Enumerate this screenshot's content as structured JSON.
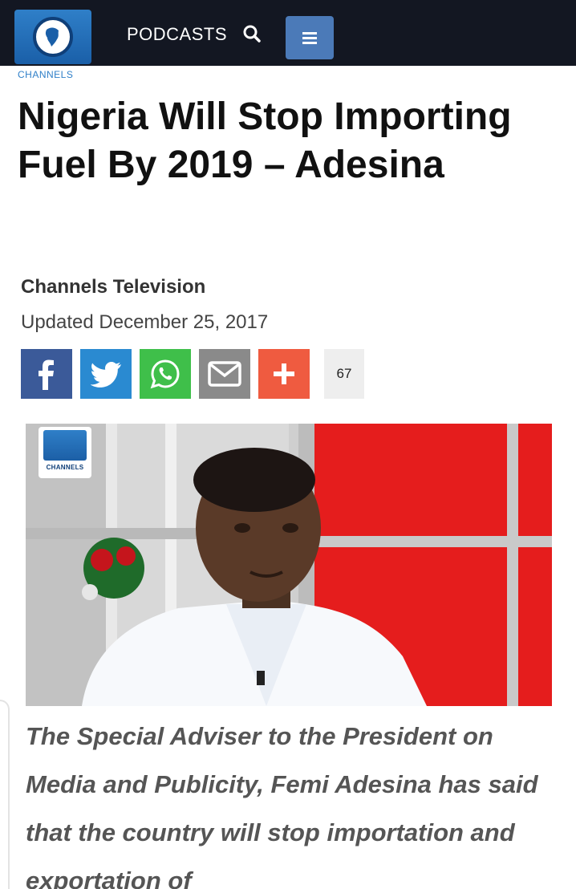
{
  "header": {
    "logo_text": "CHANNELS",
    "podcasts_label": "PODCASTS",
    "search_icon": "search-icon",
    "menu_icon": "hamburger-icon",
    "colors": {
      "bar": "#131722",
      "logo": "#2f7fc8",
      "menu": "#4b7ab8"
    }
  },
  "article": {
    "title": "Nigeria Will Stop Importing Fuel By 2019 – Adesina",
    "author": "Channels Television",
    "updated": "Updated December 25, 2017"
  },
  "share": {
    "buttons": [
      {
        "name": "facebook",
        "icon": "facebook-icon",
        "color": "#3b5a99"
      },
      {
        "name": "twitter",
        "icon": "twitter-icon",
        "color": "#2a8ad1"
      },
      {
        "name": "whatsapp",
        "icon": "whatsapp-icon",
        "color": "#3fbf4a"
      },
      {
        "name": "email",
        "icon": "email-icon",
        "color": "#8a8a8a"
      },
      {
        "name": "more",
        "icon": "plus-icon",
        "color": "#ef5b40"
      }
    ],
    "count": "67"
  },
  "photo": {
    "watermark_text": "CHANNELS"
  },
  "lead": "The Special Adviser to the President on Media and Publicity, Femi Adesina has said that the country will stop importation and exportation of"
}
